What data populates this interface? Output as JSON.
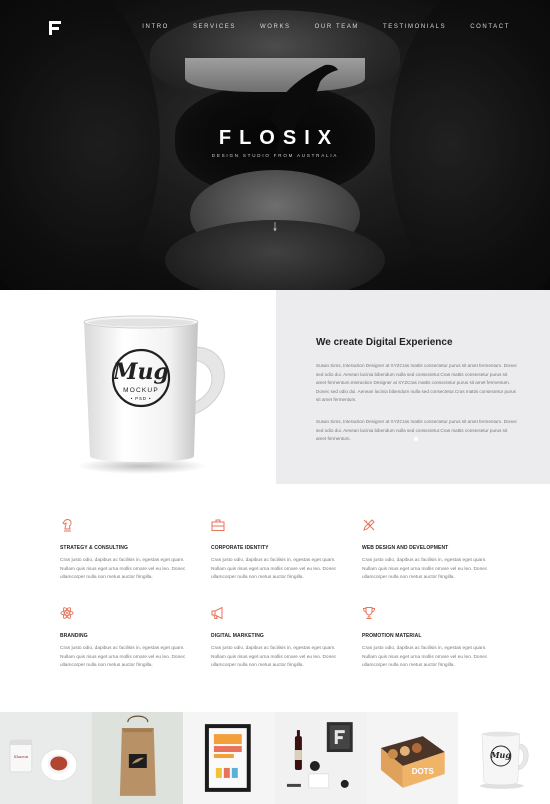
{
  "brand": {
    "logo_letter": "F",
    "accent": "#e8735a"
  },
  "nav": {
    "items": [
      "INTRO",
      "SERVICES",
      "WORKS",
      "OUR TEAM",
      "TESTIMONIALS",
      "CONTACT"
    ]
  },
  "hero": {
    "title": "FLOSIX",
    "subtitle": "DESIGN STUDIO FROM AUSTRALIA"
  },
  "about": {
    "mug_script": "Mug",
    "mug_label": "MOCKUP",
    "mug_psd": "• PSD •",
    "title": "We create Digital Experience",
    "paragraph1": "Susan Sims, Interaction Designer at XYZCras mattis consectetur purus sit amet fermentum. Donec sed odio dui. Aenean lacinia bibendum nulla sed consectetur.Cras mattis consectetur purus sit amet fermentum.Interaction Designer at XYZCras mattis consectetur purus sit amet fermentum. Donec sed odio dui. Aenean lacinia bibendum nulla sed consectetur.Cras mattis consectetur purus sit amet fermentum.",
    "paragraph2": "Susan Sims, Interaction Designer at XYZCras mattis consectetur purus sit amet fermentum. Donec sed odio dui. Aenean lacinia bibendum nulla sed consectetur.Cras mattis consectetur purus sit amet fermentum."
  },
  "services": [
    {
      "icon": "chess-knight-icon",
      "title": "STRATEGY & CONSULTING",
      "text": "Cras justo odio, dapibus ac facilisis in, egestas eget quam. Nullam quis risus eget urna mollis ornare vel eu leo. Donec ullamcorper nulla non metus auctor fringilla."
    },
    {
      "icon": "briefcase-icon",
      "title": "CORPORATE IDENTITY",
      "text": "Cras justo odio, dapibus ac facilisis in, egestas eget quam. Nullam quis risus eget urna mollis ornare vel eu leo. Donec ullamcorper nulla non metus auctor fringilla."
    },
    {
      "icon": "pencil-ruler-icon",
      "title": "WEB DESIGN AND DEVELOPMENT",
      "text": "Cras justo odio, dapibus ac facilisis in, egestas eget quam. Nullam quis risus eget urna mollis ornare vel eu leo. Donec ullamcorper nulla non metus auctor fringilla."
    },
    {
      "icon": "atom-icon",
      "title": "BRANDING",
      "text": "Cras justo odio, dapibus ac facilisis in, egestas eget quam. Nullam quis risus eget urna mollis ornare vel eu leo. Donec ullamcorper nulla non metus auctor fringilla."
    },
    {
      "icon": "megaphone-icon",
      "title": "DIGITAL MARKETING",
      "text": "Cras justo odio, dapibus ac facilisis in, egestas eget quam. Nullam quis risus eget urna mollis ornare vel eu leo. Donec ullamcorper nulla non metus auctor fringilla."
    },
    {
      "icon": "trophy-icon",
      "title": "PROMOTION MATERIAL",
      "text": "Cras justo odio, dapibus ac facilisis in, egestas eget quam. Nullam quis risus eget urna mollis ornare vel eu leo. Donec ullamcorper nulla non metus auctor fringilla."
    }
  ],
  "portfolio": [
    {
      "name": "tea-cup-mockup",
      "caption": ""
    },
    {
      "name": "paper-bag-mockup",
      "caption": ""
    },
    {
      "name": "poster-frame-mockup",
      "caption": ""
    },
    {
      "name": "stationery-mockup",
      "caption": ""
    },
    {
      "name": "donut-box-mockup",
      "caption": "DOTS"
    },
    {
      "name": "mug-mockup",
      "caption": "Mug"
    }
  ]
}
